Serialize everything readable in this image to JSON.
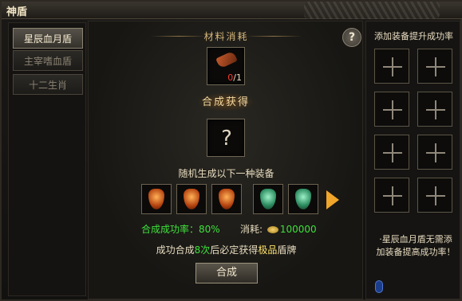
{
  "window": {
    "title": "神盾"
  },
  "sidebar": {
    "tabs": [
      {
        "label": "星辰血月盾",
        "active": true
      },
      {
        "label": "主宰嗜血盾",
        "active": false
      },
      {
        "label": "十二生肖",
        "active": false
      }
    ]
  },
  "center": {
    "materials_title": "材料消耗",
    "help_icon": "?",
    "material_count_have": "0",
    "material_count_need": "/1",
    "synth_result_label": "合成获得",
    "result_placeholder": "?",
    "random_equip_text": "随机生成以下一种装备",
    "equipment": [
      {
        "icon": "fire-shield-icon"
      },
      {
        "icon": "fire-shield-icon"
      },
      {
        "icon": "fire-shield-icon"
      },
      {
        "icon": "jade-shield-icon"
      },
      {
        "icon": "jade-shield-icon"
      }
    ],
    "success_rate_label": "合成成功率：",
    "success_rate_value": "80%",
    "cost_label": "消耗:",
    "cost_value": "100000",
    "success_text_pre": "成功合成",
    "success_text_count": "8次",
    "success_text_mid": "后必定获得",
    "success_text_quality": "极品",
    "success_text_post": "盾牌",
    "synth_button": "合成"
  },
  "right": {
    "title": "添加装备提升成功率",
    "note": "·星辰血月盾无需添加装备提高成功率！"
  },
  "colors": {
    "green": "#3fe03c",
    "yellow": "#ffe36a",
    "red": "#ff3b2a",
    "arrow": "#f0a52b"
  }
}
